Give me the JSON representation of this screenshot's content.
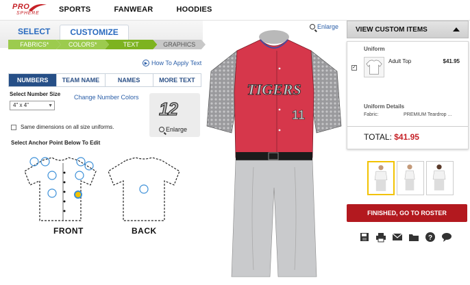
{
  "brand": {
    "logo_top": "PRO",
    "logo_bottom": "SPHERE"
  },
  "nav": [
    {
      "label": "SPORTS"
    },
    {
      "label": "FANWEAR"
    },
    {
      "label": "HOODIES"
    }
  ],
  "tabs": {
    "select": "SELECT",
    "customize": "CUSTOMIZE"
  },
  "steps": [
    {
      "label": "FABRICS*",
      "state": "done"
    },
    {
      "label": "COLORS*",
      "state": "done"
    },
    {
      "label": "TEXT",
      "state": "current"
    },
    {
      "label": "GRAPHICS",
      "state": "todo"
    }
  ],
  "how_to_apply": "How To Apply Text",
  "subtabs": [
    {
      "label": "NUMBERS",
      "active": true
    },
    {
      "label": "TEAM NAME",
      "active": false
    },
    {
      "label": "NAMES",
      "active": false
    },
    {
      "label": "MORE TEXT",
      "active": false
    }
  ],
  "number_size": {
    "label": "Select Number Size",
    "value": "4\" x 4\""
  },
  "change_colors": "Change Number Colors",
  "preview": {
    "number": "12",
    "enlarge": "Enlarge"
  },
  "same_dimensions": "Same dimensions on all size uniforms.",
  "anchor_title": "Select Anchor Point Below To Edit",
  "front_label": "FRONT",
  "back_label": "BACK",
  "enlarge_top": "Enlarge",
  "jersey": {
    "team_text": "TIGERS",
    "number": "11",
    "body_color": "#d6374b",
    "sleeve_color": "#8f8f92",
    "pants_color": "#c9cacc",
    "belt_color": "#1b1b1b"
  },
  "right": {
    "view_custom_items": "VIEW CUSTOM ITEMS",
    "uniform_head": "Uniform",
    "item_name": "Adult Top",
    "item_price": "$41.95",
    "details_head": "Uniform Details",
    "fabric_label": "Fabric:",
    "fabric_value": "PREMIUM Teardrop ...",
    "total_label": "TOTAL:",
    "total_value": "$41.95",
    "finish_label": "FINISHED, GO TO ROSTER"
  },
  "colors": {
    "accent_blue": "#264f87",
    "accent_red": "#b3191f",
    "step_green": "#9ccb4e",
    "thumb_selected": "#f2c200"
  },
  "icons": [
    "save-icon",
    "print-icon",
    "share-icon",
    "folder-icon",
    "help-icon",
    "chat-icon"
  ]
}
